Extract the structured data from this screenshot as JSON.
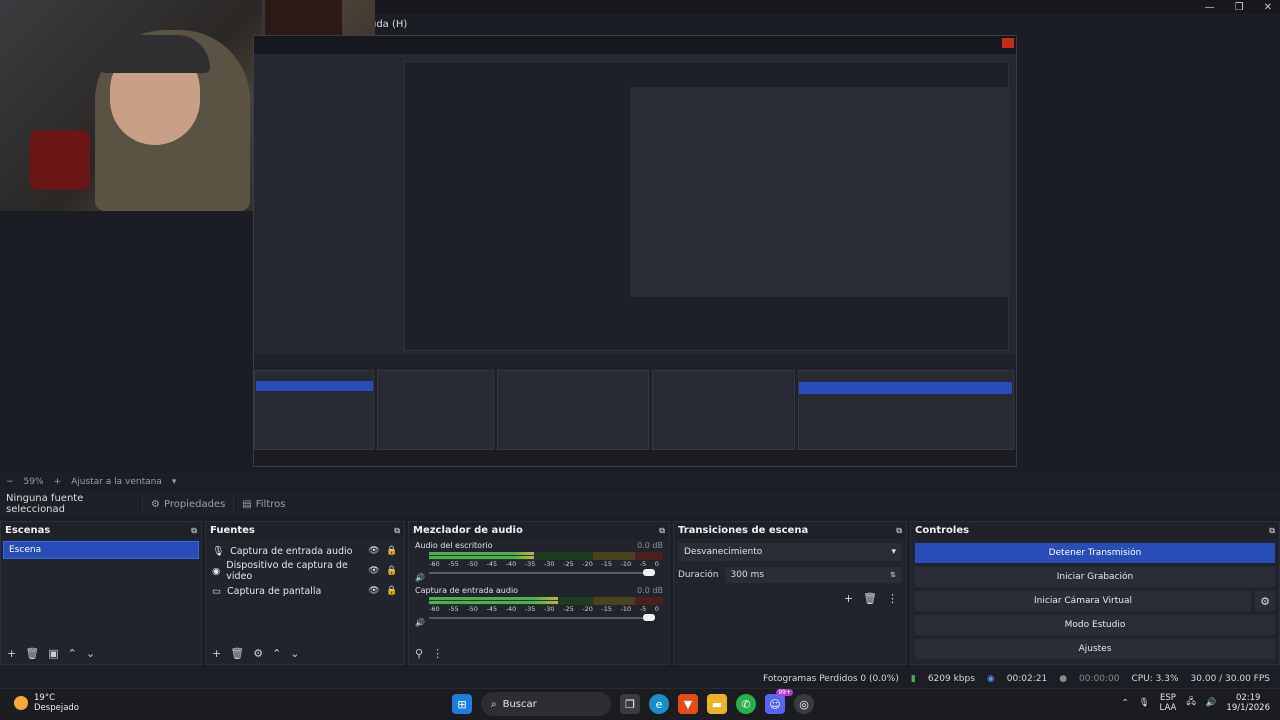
{
  "preview": {
    "menu_text": "uda (H)",
    "zoom": "59%",
    "fit_label": "Ajustar a la ventana",
    "window_controls": [
      "—",
      "❐",
      "✕"
    ]
  },
  "source_toolbar": {
    "no_source": "Ninguna fuente seleccionad",
    "properties": "Propiedades",
    "filters": "Filtros"
  },
  "scenes": {
    "title": "Escenas",
    "items": [
      "Escena"
    ]
  },
  "sources": {
    "title": "Fuentes",
    "items": [
      {
        "label": "Captura de entrada audio",
        "icon": "microphone-icon"
      },
      {
        "label": "Dispositivo de captura de video",
        "icon": "camera-icon"
      },
      {
        "label": "Captura de pantalla",
        "icon": "monitor-icon"
      }
    ]
  },
  "mixer": {
    "title": "Mezclador de audio",
    "channels": [
      {
        "name": "Audio del escritorio",
        "db": "0.0 dB",
        "level": 0.45
      },
      {
        "name": "Captura de entrada audio",
        "db": "0.0 dB",
        "level": 0.55
      }
    ],
    "scale": [
      "-60",
      "-55",
      "-50",
      "-45",
      "-40",
      "-35",
      "-30",
      "-25",
      "-20",
      "-15",
      "-10",
      "-5",
      "0"
    ]
  },
  "transitions": {
    "title": "Transiciones de escena",
    "selected": "Desvanecimiento",
    "duration_label": "Duración",
    "duration_value": "300 ms"
  },
  "controls": {
    "title": "Controles",
    "stop_stream": "Detener Transmisión",
    "start_recording": "Iniciar Grabación",
    "start_virtual_cam": "Iniciar Cámara Virtual",
    "studio_mode": "Modo Estudio",
    "settings": "Ajustes"
  },
  "status": {
    "dropped_frames": "Fotogramas Perdidos 0 (0.0%)",
    "bitrate": "6209 kbps",
    "stream_time": "00:02:21",
    "rec_time": "00:00:00",
    "cpu": "CPU: 3.3%",
    "fps": "30.00 / 30.00 FPS"
  },
  "taskbar": {
    "temp": "19°C",
    "weather": "Despejado",
    "search": "Buscar",
    "badge": "99+",
    "lang_top": "ESP",
    "lang_bottom": "LAA",
    "time": "02:19",
    "date": "19/1/2026"
  },
  "colors": {
    "accent": "#284cb8",
    "meter_green": "#4caf50",
    "meter_yellow": "#c9b23a",
    "meter_red": "#c43030"
  }
}
